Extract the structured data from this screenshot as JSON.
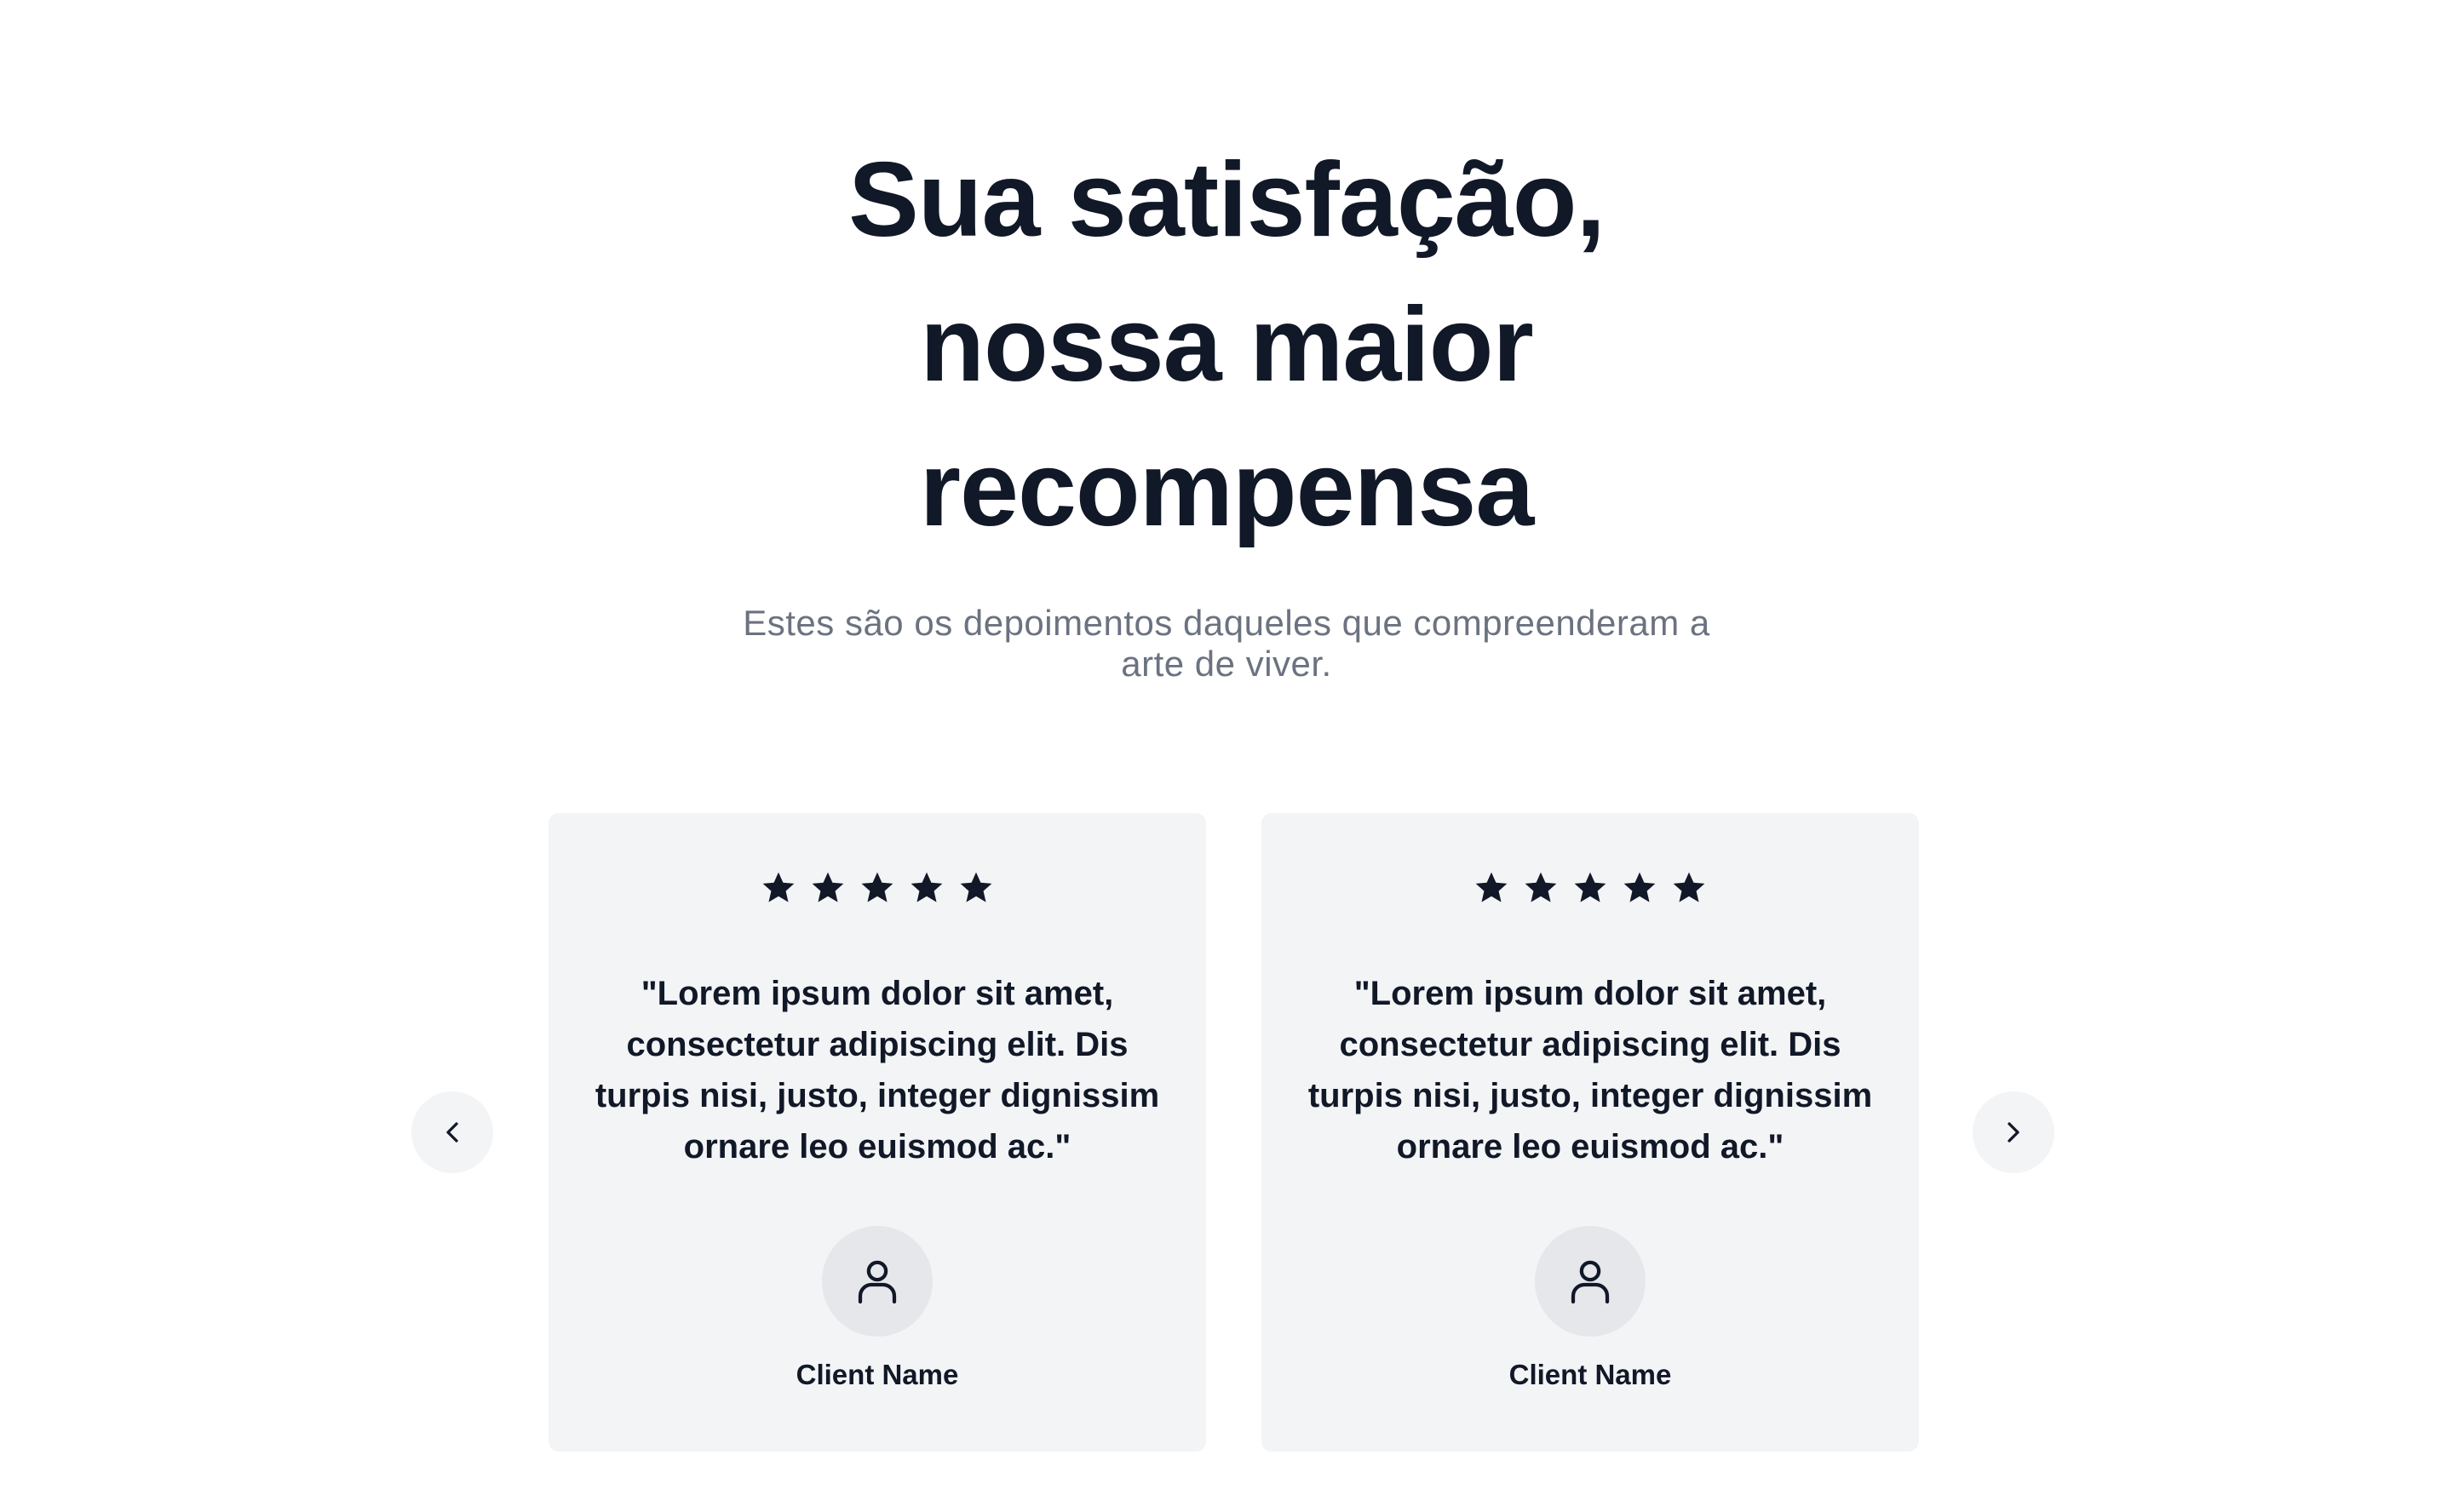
{
  "hero": {
    "title_line1": "Sua satisfação,",
    "title_line2": "nossa maior",
    "title_line3": "recompensa",
    "subtitle": "Estes são os depoimentos daqueles que compreenderam a arte de viver."
  },
  "carousel": {
    "prev_icon": "chevron-left-icon",
    "next_icon": "chevron-right-icon",
    "testimonials": [
      {
        "rating": 5,
        "quote": "\"Lorem ipsum dolor sit amet, consectetur adipiscing elit. Dis turpis nisi, justo, integer dignissim ornare leo euismod ac.\"",
        "avatar_icon": "user-icon",
        "client_name": "Client Name"
      },
      {
        "rating": 5,
        "quote": "\"Lorem ipsum dolor sit amet, consectetur adipiscing elit. Dis turpis nisi, justo, integer dignissim ornare leo euismod ac.\"",
        "avatar_icon": "user-icon",
        "client_name": "Client Name"
      }
    ]
  },
  "colors": {
    "text_dark": "#111827",
    "text_muted": "#6b7280",
    "card_bg": "#f3f4f6",
    "avatar_bg": "#e5e7eb"
  }
}
